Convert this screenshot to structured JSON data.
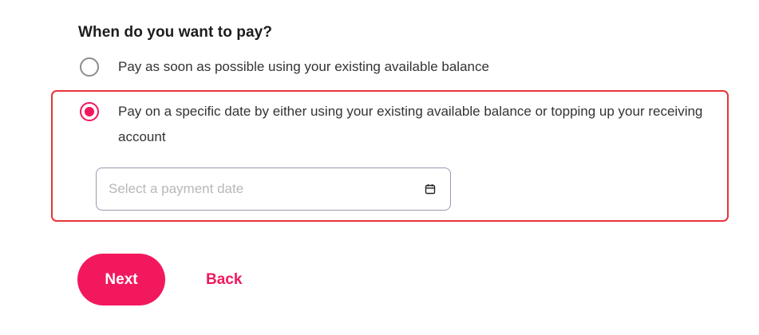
{
  "question": {
    "title": "When do you want to pay?"
  },
  "options": [
    {
      "label": "Pay as soon as possible using your existing available balance",
      "selected": false
    },
    {
      "label": "Pay on a specific date by either using your existing available balance or topping up your receiving account",
      "selected": true
    }
  ],
  "date_field": {
    "value": "",
    "placeholder": "Select a payment date",
    "icon": "calendar-icon"
  },
  "actions": {
    "next_label": "Next",
    "back_label": "Back"
  },
  "colors": {
    "accent": "#f2185d",
    "highlight_border": "#e8343a",
    "text": "#333333",
    "radio_unselected": "#8c8c8c",
    "input_border": "#9a9ab0"
  }
}
